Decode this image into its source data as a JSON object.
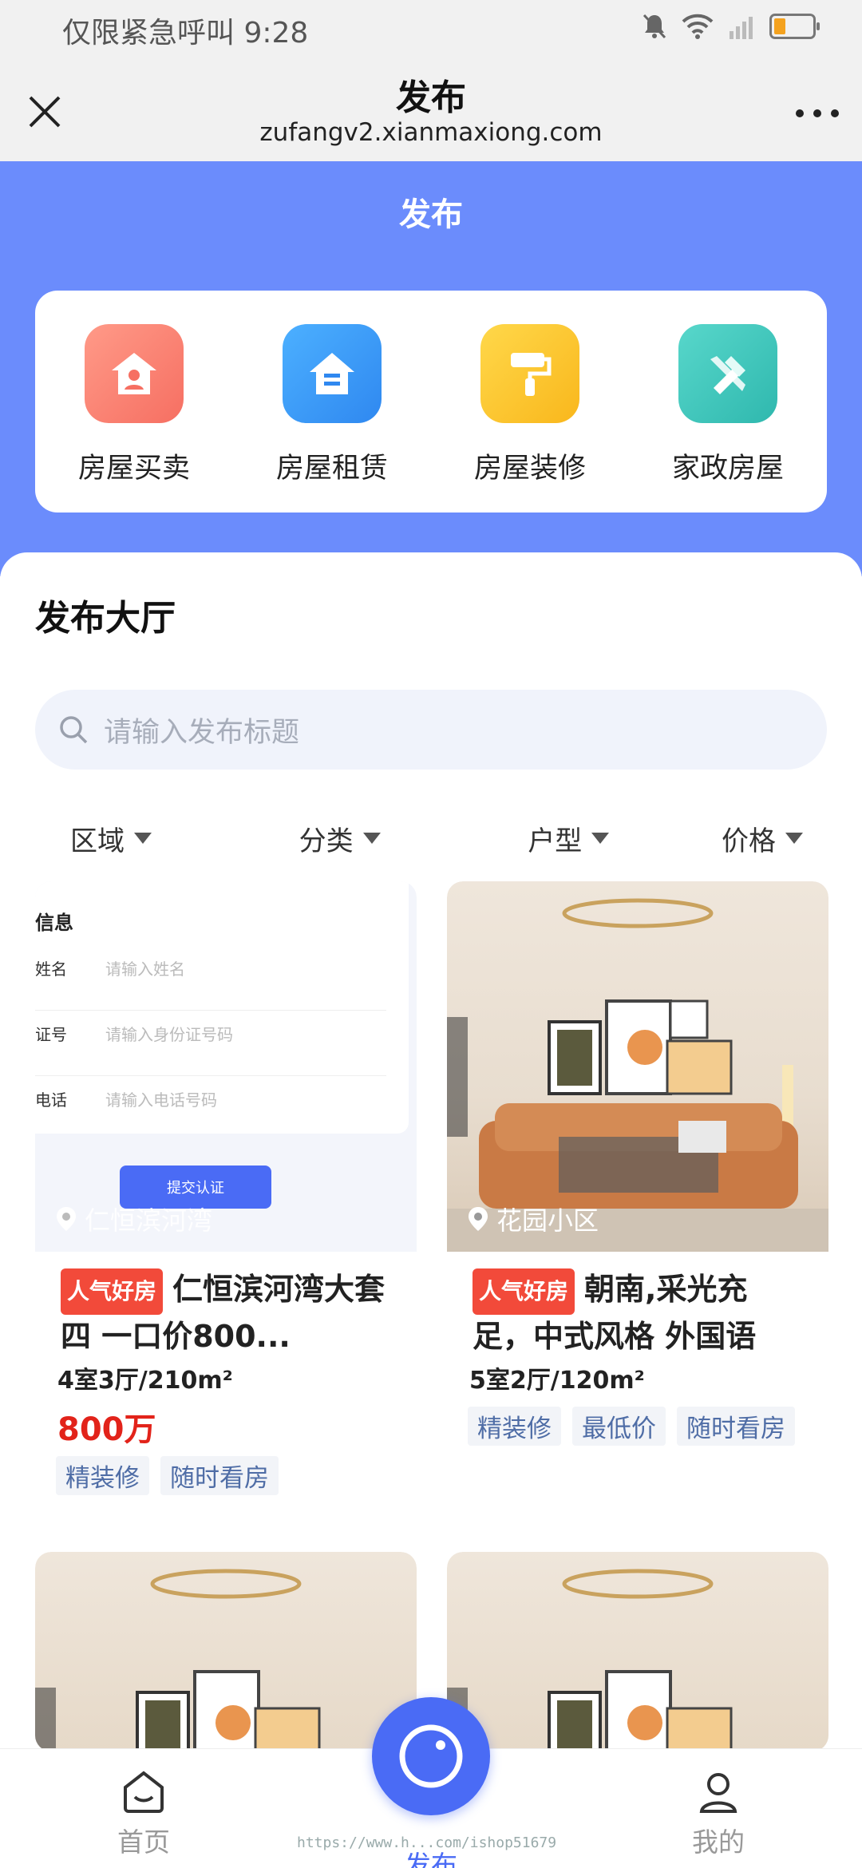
{
  "status_bar": {
    "left_text": "仅限紧急呼叫",
    "time": "9:28"
  },
  "nav": {
    "title": "发布",
    "url": "zufangv2.xianmaxiong.com"
  },
  "hero": {
    "title": "发布"
  },
  "categories": [
    {
      "label": "房屋买卖",
      "icon": "house-icon",
      "color": "#fb7f72"
    },
    {
      "label": "房屋租赁",
      "icon": "house-rent-icon",
      "color": "#3b9cf6"
    },
    {
      "label": "房屋装修",
      "icon": "paint-roller-icon",
      "color": "#fcc830"
    },
    {
      "label": "家政房屋",
      "icon": "tools-icon",
      "color": "#3ec7bd"
    }
  ],
  "hall": {
    "title": "发布大厅",
    "search_placeholder": "请输入发布标题"
  },
  "filters": [
    "区域",
    "分类",
    "户型",
    "价格"
  ],
  "listings": [
    {
      "location": "仁恒滨河湾",
      "badge": "人气好房",
      "title": "仁恒滨河湾大套四 一口价800...",
      "spec": "4室3厅/210m²",
      "price": "800万",
      "tags": [
        "精装修",
        "随时看房"
      ],
      "form_preview": {
        "heading": "信息",
        "rows": [
          {
            "label": "姓名",
            "placeholder": "请输入姓名"
          },
          {
            "label": "证号",
            "placeholder": "请输入身份证号码"
          },
          {
            "label": "电话",
            "placeholder": "请输入电话号码"
          }
        ],
        "button": "提交认证"
      }
    },
    {
      "location": "花园小区",
      "badge": "人气好房",
      "title": "朝南,采光充足，中式风格 外国语",
      "spec": "5室2厅/120m²",
      "tags": [
        "精装修",
        "最低价",
        "随时看房"
      ]
    }
  ],
  "tabbar": {
    "home": "首页",
    "publish": "发布",
    "mine": "我的"
  },
  "watermark": "https://www.h...com/ishop51679",
  "colors": {
    "hero": "#6b8cfc",
    "accent": "#4a6bf5",
    "price": "#e2231a",
    "badge": "#f24a3a"
  }
}
